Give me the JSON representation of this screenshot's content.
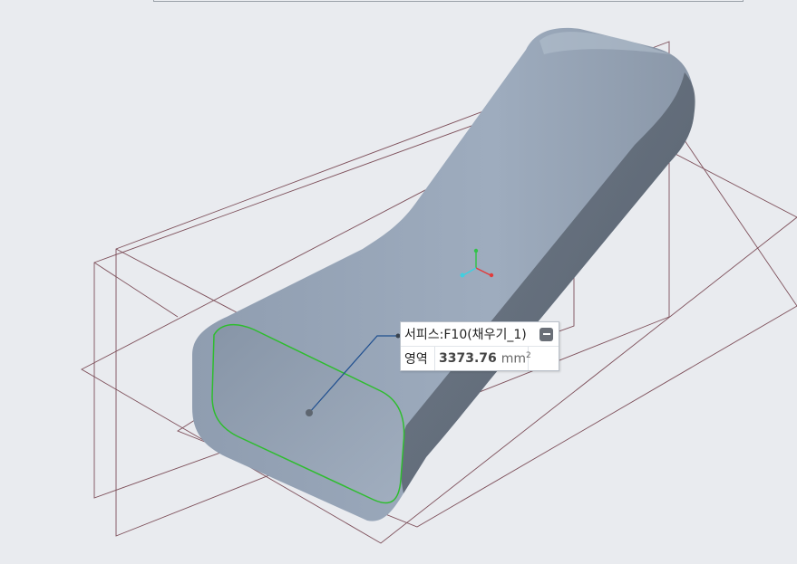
{
  "callout": {
    "title": "서피스:F10(채우기_1)",
    "property_label": "영역",
    "value": "3373.76",
    "unit": "mm",
    "unit_exponent": "2",
    "collapse_icon": "minus-icon"
  },
  "colors": {
    "background": "#e9ebef",
    "solid": "#94a2b4",
    "datum_lines": "#6b3440",
    "selected_edge": "#2ebd2e",
    "leader": "#1f4f8f",
    "csys_x": "#e23b3b",
    "csys_y": "#33c24a",
    "csys_z": "#3fd0e0"
  }
}
